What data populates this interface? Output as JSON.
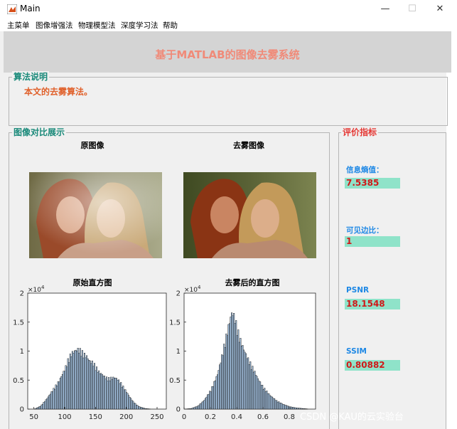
{
  "window": {
    "title": "Main",
    "minimize": "—",
    "maximize": "☐",
    "close": "✕"
  },
  "menu": [
    "主菜单",
    "图像增强法",
    "物理模型法",
    "深度学习法",
    "帮助"
  ],
  "header": {
    "title": "基于MATLAB的图像去雾系统"
  },
  "algorithm_panel": {
    "legend": "算法说明",
    "text": "本文的去雾算法。"
  },
  "compare_panel": {
    "legend": "图像对比展示",
    "original_label": "原图像",
    "dehazed_label": "去雾图像",
    "hist_original_label": "原始直方图",
    "hist_dehazed_label": "去雾后的直方图"
  },
  "metrics_panel": {
    "legend": "评价指标",
    "items": [
      {
        "label": "信息熵值：",
        "value": "7.5385"
      },
      {
        "label": "可见边比：",
        "value": "1"
      },
      {
        "label": "PSNR",
        "value": "18.1548"
      },
      {
        "label": "SSIM",
        "value": "0.80882"
      }
    ]
  },
  "watermark": "CSDN @KAU的云实验台",
  "colors": {
    "title": "#f08a78",
    "algo_legend": "#1a8a7a",
    "metric_legend": "#e53935",
    "metric_value_bg": "#8fe3c9",
    "metric_value_text": "#d01818"
  },
  "chart_data": [
    {
      "type": "bar",
      "title": "原始直方图",
      "exponent_label": "×10",
      "exponent_power": "4",
      "xlim": [
        40,
        265
      ],
      "ylim": [
        0,
        2
      ],
      "xticks": [
        50,
        100,
        150,
        200,
        250
      ],
      "yticks": [
        0,
        0.5,
        1,
        1.5,
        2
      ],
      "x": [
        40,
        50,
        60,
        70,
        80,
        90,
        100,
        105,
        110,
        115,
        120,
        125,
        130,
        135,
        140,
        145,
        150,
        155,
        160,
        165,
        170,
        175,
        180,
        185,
        190,
        195,
        200,
        205,
        210,
        215,
        220,
        230,
        240,
        250,
        255
      ],
      "values": [
        0,
        0,
        0.05,
        0.17,
        0.32,
        0.47,
        0.68,
        0.83,
        0.93,
        0.97,
        1.0,
        0.98,
        0.92,
        0.88,
        0.8,
        0.78,
        0.7,
        0.62,
        0.58,
        0.53,
        0.51,
        0.52,
        0.53,
        0.5,
        0.44,
        0.36,
        0.28,
        0.2,
        0.13,
        0.08,
        0.04,
        0.01,
        0,
        0,
        0
      ]
    },
    {
      "type": "bar",
      "title": "去雾后的直方图",
      "exponent_label": "×10",
      "exponent_power": "4",
      "xlim": [
        0,
        1
      ],
      "ylim": [
        0,
        2
      ],
      "xticks": [
        0,
        0.2,
        0.4,
        0.6,
        0.8
      ],
      "yticks": [
        0,
        0.5,
        1,
        1.5,
        2
      ],
      "x": [
        0,
        0.05,
        0.1,
        0.15,
        0.2,
        0.25,
        0.28,
        0.31,
        0.34,
        0.36,
        0.38,
        0.4,
        0.42,
        0.45,
        0.48,
        0.52,
        0.56,
        0.6,
        0.65,
        0.7,
        0.75,
        0.8,
        0.85,
        0.9,
        0.95,
        1.0
      ],
      "values": [
        0,
        0.01,
        0.05,
        0.15,
        0.32,
        0.58,
        0.85,
        1.15,
        1.45,
        1.62,
        1.55,
        1.35,
        1.18,
        1.0,
        0.85,
        0.68,
        0.5,
        0.36,
        0.23,
        0.14,
        0.08,
        0.04,
        0.02,
        0.01,
        0,
        0
      ]
    }
  ]
}
